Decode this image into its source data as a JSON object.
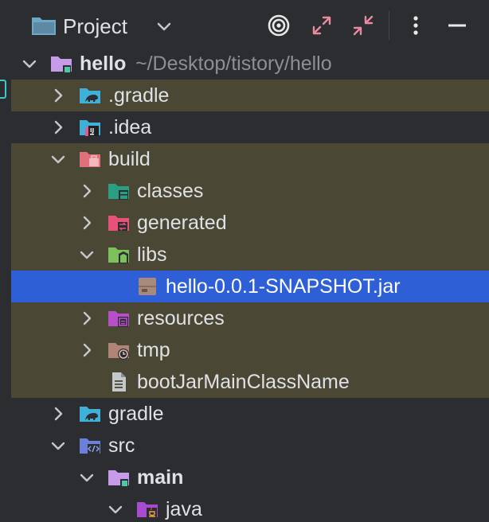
{
  "header": {
    "title": "Project",
    "buttons": [
      "target-icon",
      "expand-icon",
      "collapse-icon",
      "more-icon",
      "hide-icon"
    ]
  },
  "tree": {
    "items": [
      {
        "label": "hello",
        "path": "~/Desktop/tistory/hello",
        "depth": 0,
        "expanded": true,
        "icon": "module-folder-icon",
        "bold": true,
        "style": "plain"
      },
      {
        "label": ".gradle",
        "depth": 1,
        "expanded": false,
        "icon": "gradle-folder-icon",
        "bold": false,
        "style": "muted"
      },
      {
        "label": ".idea",
        "depth": 1,
        "expanded": false,
        "icon": "idea-folder-icon",
        "bold": false,
        "style": "plain"
      },
      {
        "label": "build",
        "depth": 1,
        "expanded": true,
        "icon": "build-folder-icon",
        "bold": false,
        "style": "muted"
      },
      {
        "label": "classes",
        "depth": 2,
        "expanded": false,
        "icon": "classes-folder-icon",
        "bold": false,
        "style": "muted"
      },
      {
        "label": "generated",
        "depth": 2,
        "expanded": false,
        "icon": "generated-folder-icon",
        "bold": false,
        "style": "muted"
      },
      {
        "label": "libs",
        "depth": 2,
        "expanded": true,
        "icon": "libs-folder-icon",
        "bold": false,
        "style": "muted"
      },
      {
        "label": "hello-0.0.1-SNAPSHOT.jar",
        "depth": 3,
        "icon": "jar-file-icon",
        "bold": false,
        "style": "selected"
      },
      {
        "label": "resources",
        "depth": 2,
        "expanded": false,
        "icon": "resources-folder-icon",
        "bold": false,
        "style": "muted"
      },
      {
        "label": "tmp",
        "depth": 2,
        "expanded": false,
        "icon": "tmp-folder-icon",
        "bold": false,
        "style": "muted"
      },
      {
        "label": "bootJarMainClassName",
        "depth": 2,
        "icon": "text-file-icon",
        "bold": false,
        "style": "muted"
      },
      {
        "label": "gradle",
        "depth": 1,
        "expanded": false,
        "icon": "gradle-folder-icon",
        "bold": false,
        "style": "plain"
      },
      {
        "label": "src",
        "depth": 1,
        "expanded": true,
        "icon": "src-folder-icon",
        "bold": false,
        "style": "plain"
      },
      {
        "label": "main",
        "depth": 2,
        "expanded": true,
        "icon": "module-folder-icon",
        "bold": true,
        "style": "plain"
      },
      {
        "label": "java",
        "depth": 3,
        "expanded": true,
        "icon": "java-source-folder-icon",
        "bold": false,
        "style": "plain"
      }
    ]
  },
  "colors": {
    "background": "#2b2d30",
    "muted_row": "#4b4735",
    "selected_row": "#2e5fd6",
    "text": "#dfe1e5",
    "path_text": "#8c8f94"
  }
}
